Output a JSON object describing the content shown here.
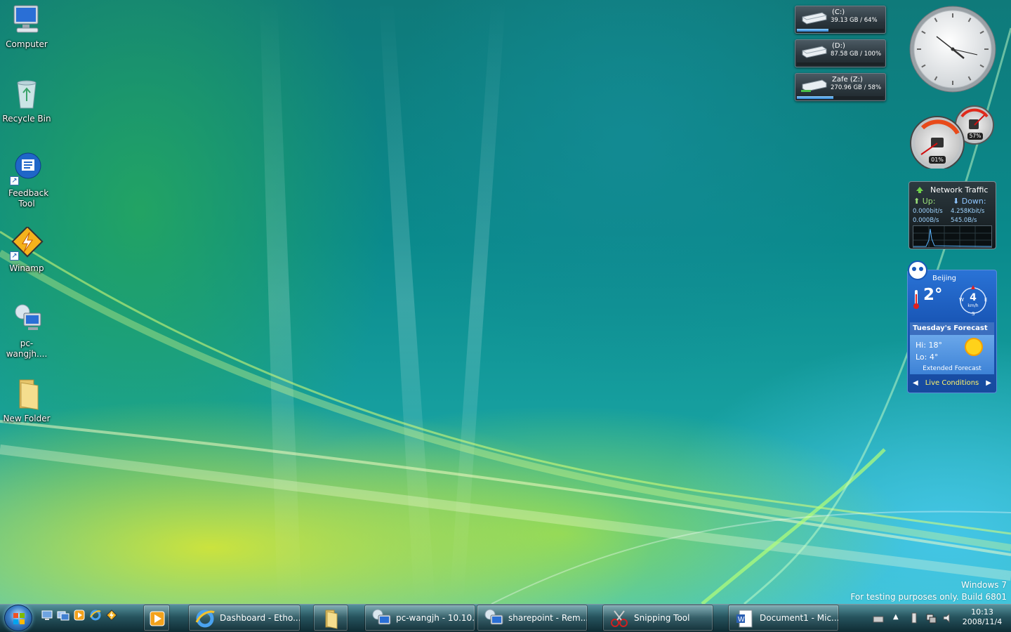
{
  "desktop": {
    "icons": [
      {
        "label": "Computer",
        "icon": "computer-icon"
      },
      {
        "label": "Recycle Bin",
        "icon": "recycle-bin-icon"
      },
      {
        "label": "Feedback Tool",
        "icon": "feedback-tool-icon"
      },
      {
        "label": "Winamp",
        "icon": "winamp-icon"
      },
      {
        "label": "pc-wangjh....",
        "icon": "remote-desktop-icon"
      },
      {
        "label": "New Folder",
        "icon": "folder-icon"
      }
    ]
  },
  "gadgets": {
    "drives": [
      {
        "name": "(C:)",
        "info": "39.13 GB / 64%",
        "usage": 0.36
      },
      {
        "name": "(D:)",
        "info": "87.58 GB / 100%",
        "usage": 0.0
      },
      {
        "name": "Zafe (Z:)",
        "info": "270.96 GB / 58%",
        "usage": 0.42
      }
    ],
    "cpu_meter": {
      "cpu": "01%",
      "ram": "57%"
    },
    "network": {
      "title": "Network Traffic",
      "up_label": "Up:",
      "down_label": "Down:",
      "up_bits": "0.000bit/s",
      "up_bytes": "0.000B/s",
      "down_bits": "4.258Kbit/s",
      "down_bytes": "545.0B/s"
    },
    "weather": {
      "city": "Beijing",
      "temp": "2°",
      "wind_speed": "4",
      "wind_unit": "km/h",
      "compass": {
        "w": "W",
        "e": "E",
        "s": "S"
      },
      "forecast_title": "Tuesday's Forecast",
      "hi": "Hi:  18°",
      "lo": "Lo:  4°",
      "extended": "Extended Forecast",
      "live": "Live Conditions"
    }
  },
  "watermark": {
    "line1": "Windows 7",
    "line2": "For testing purposes only. Build 6801"
  },
  "taskbar": {
    "start_icon": "windows-logo-icon",
    "quick_launch": [
      "show-desktop-icon",
      "switch-windows-icon",
      "media-player-icon",
      "internet-explorer-icon",
      "winamp-icon"
    ],
    "tasks": [
      {
        "label": "",
        "icon": "media-player-icon"
      },
      {
        "label": "Dashboard - Etho...",
        "icon": "internet-explorer-icon"
      },
      {
        "label": "",
        "icon": "explorer-folder-icon"
      },
      {
        "label": "pc-wangjh - 10.10...",
        "icon": "remote-desktop-icon"
      },
      {
        "label": "sharepoint - Rem...",
        "icon": "remote-desktop-icon"
      },
      {
        "label": "Snipping Tool",
        "icon": "snipping-tool-icon"
      },
      {
        "label": "Document1 - Mic...",
        "icon": "word-document-icon"
      }
    ],
    "clock": {
      "time": "10:13",
      "date": "2008/11/4"
    }
  }
}
